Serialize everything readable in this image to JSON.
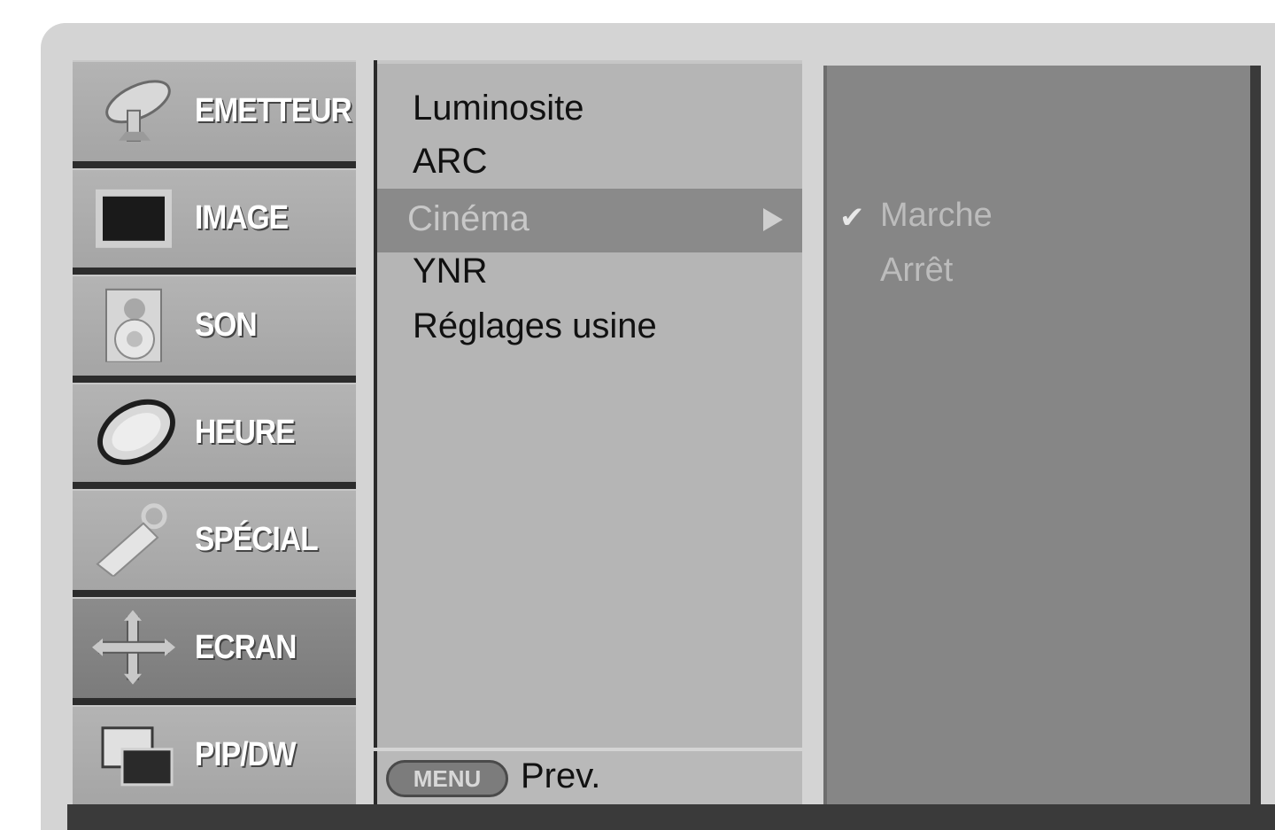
{
  "sidebar": {
    "items": [
      {
        "label": "EMETTEUR",
        "icon": "satellite-dish-icon",
        "active": false
      },
      {
        "label": "IMAGE",
        "icon": "tv-screen-icon",
        "active": false
      },
      {
        "label": "SON",
        "icon": "speaker-icon",
        "active": false
      },
      {
        "label": "HEURE",
        "icon": "clock-icon",
        "active": false
      },
      {
        "label": "SPÉCIAL",
        "icon": "key-tag-icon",
        "active": false
      },
      {
        "label": "ECRAN",
        "icon": "move-arrows-icon",
        "active": true
      },
      {
        "label": "PIP/DW",
        "icon": "pip-windows-icon",
        "active": false
      }
    ]
  },
  "menu": {
    "items": [
      "Luminosite",
      "ARC",
      "Cinéma",
      "YNR",
      "Réglages usine"
    ],
    "selected": "Cinéma"
  },
  "submenu": {
    "options": [
      "Marche",
      "Arrêt"
    ],
    "checked": "Marche"
  },
  "footer": {
    "button_label": "MENU",
    "prev_label": "Prev."
  },
  "colors": {
    "frame": "#d4d4d4",
    "sidebar": "#aaaaaa",
    "sidebar_active": "#808080",
    "panel": "#b5b5b5",
    "highlight": "#8a8a8a",
    "submenu_panel": "#868686"
  }
}
